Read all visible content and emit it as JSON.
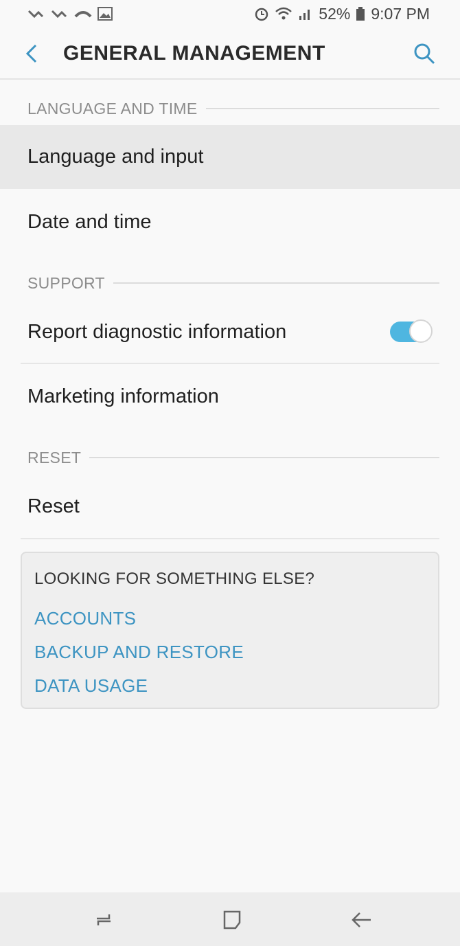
{
  "status": {
    "battery": "52%",
    "time": "9:07 PM"
  },
  "appbar": {
    "title": "GENERAL MANAGEMENT"
  },
  "sections": {
    "language_time": "LANGUAGE AND TIME",
    "support": "SUPPORT",
    "reset": "RESET"
  },
  "items": {
    "language_input": "Language and input",
    "date_time": "Date and time",
    "report_diag": "Report diagnostic information",
    "marketing": "Marketing information",
    "reset": "Reset"
  },
  "toggle": {
    "report_diag_on": true
  },
  "suggest": {
    "title": "LOOKING FOR SOMETHING ELSE?",
    "links": [
      "ACCOUNTS",
      "BACKUP AND RESTORE",
      "DATA USAGE"
    ]
  },
  "colors": {
    "accent": "#4fb6e0",
    "link": "#3d94c2"
  }
}
